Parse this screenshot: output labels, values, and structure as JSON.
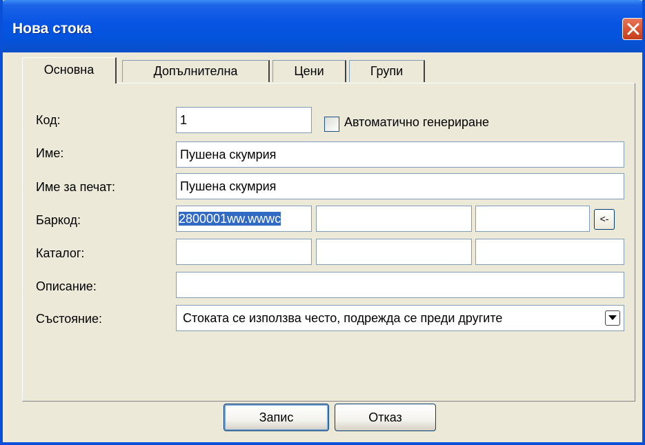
{
  "window": {
    "title": "Нова стока"
  },
  "tabs": [
    {
      "label": "Основна",
      "active": true
    },
    {
      "label": "Допълнителна",
      "active": false
    },
    {
      "label": "Цени",
      "active": false
    },
    {
      "label": "Групи",
      "active": false
    }
  ],
  "form": {
    "code": {
      "label": "Код:",
      "value": "1"
    },
    "auto_generate": {
      "label": "Автоматично генериране",
      "checked": false
    },
    "name": {
      "label": "Име:",
      "value": "Пушена скумрия"
    },
    "print_name": {
      "label": "Име за печат:",
      "value": "Пушена скумрия"
    },
    "barcode": {
      "label": "Баркод:",
      "values": [
        "2800001ww.wwwc",
        "",
        ""
      ],
      "button_label": "<-"
    },
    "catalog": {
      "label": "Каталог:",
      "values": [
        "",
        "",
        ""
      ]
    },
    "description": {
      "label": "Описание:",
      "value": ""
    },
    "status": {
      "label": "Състояние:",
      "value": "Стоката се използва често, подрежда се преди другите"
    }
  },
  "buttons": {
    "save": "Запис",
    "cancel": "Отказ"
  },
  "colors": {
    "titlebar": "#0754e3",
    "face": "#ece9d8",
    "selection": "#316ac5",
    "close": "#d7502e"
  }
}
